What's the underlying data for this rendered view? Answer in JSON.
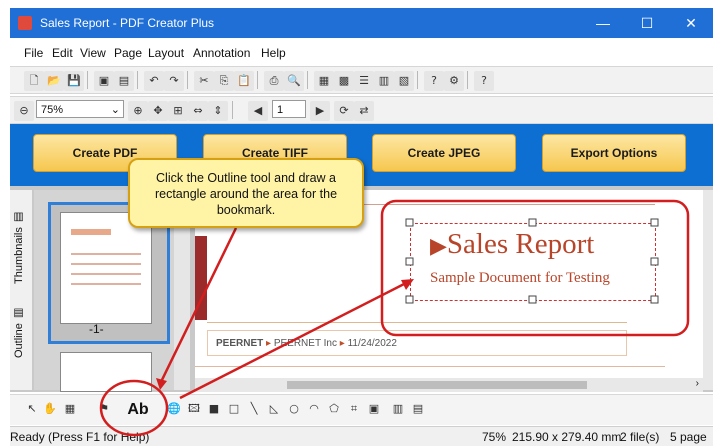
{
  "window": {
    "title": "Sales Report - PDF Creator Plus",
    "minimize": "—",
    "maximize": "☐",
    "close": "✕"
  },
  "menu": [
    "File",
    "Edit",
    "View",
    "Page",
    "Layout",
    "Annotation",
    "Help"
  ],
  "toolbar2": {
    "zoom_value": "75%",
    "page_value": "1"
  },
  "actions": {
    "create_pdf": "Create PDF",
    "create_tiff": "Create TIFF",
    "create_jpeg": "Create JPEG",
    "export_options": "Export Options"
  },
  "sidebar": {
    "thumbnails_tab": "Thumbnails",
    "outline_tab": "Outline",
    "page_label": "-1-"
  },
  "document": {
    "title": "Sales Report",
    "subtitle": "Sample Document for Testing",
    "footer_brand": "PEERNET",
    "footer_company": "PEERNET Inc",
    "footer_date": "11/24/2022"
  },
  "callout": {
    "text": "Click the Outline tool and draw a rectangle around the area for the bookmark."
  },
  "status": {
    "left": "Ready (Press F1 for Help)",
    "zoom": "75%",
    "size": "215.90 x 279.40 mm",
    "files": "2 file(s)",
    "pages": "5 page"
  },
  "colors": {
    "title_bar": "#1f6fd6",
    "action_bar": "#0d6fd1",
    "button_fill": "#f6c74f",
    "annotation_red": "#d21e1e",
    "doc_accent": "#b8452a"
  }
}
